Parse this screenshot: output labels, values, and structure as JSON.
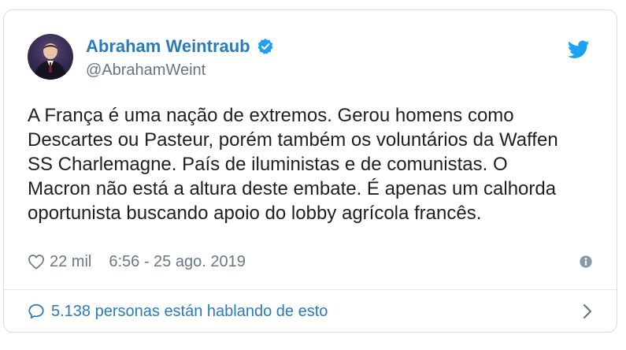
{
  "author": {
    "display_name": "Abraham Weintraub",
    "handle": "@AbrahamWeint",
    "verified": true
  },
  "tweet": {
    "text": "A França é uma nação de extremos. Gerou homens como\nDescartes ou Pasteur, porém também os voluntários da Waffen\nSS Charlemagne. País de iluministas e de comunistas. O\nMacron não está a altura deste embate. É apenas um calhorda\noportunista buscando apoio do lobby agrícola francês."
  },
  "meta": {
    "likes": "22 mil",
    "timestamp": "6:56 - 25 ago. 2019"
  },
  "footer": {
    "conversation": "5.138 personas están hablando de esto"
  },
  "icons": {
    "brand": "twitter-bird-icon",
    "verified": "verified-badge-icon",
    "like": "heart-icon",
    "info": "info-icon",
    "reply": "speech-bubble-icon",
    "chevron": "chevron-right-icon"
  },
  "colors": {
    "accent": "#2b7bb9",
    "twitter_blue": "#1da1f2",
    "text": "#1c2022",
    "muted": "#697882",
    "border": "#d7dde2"
  }
}
